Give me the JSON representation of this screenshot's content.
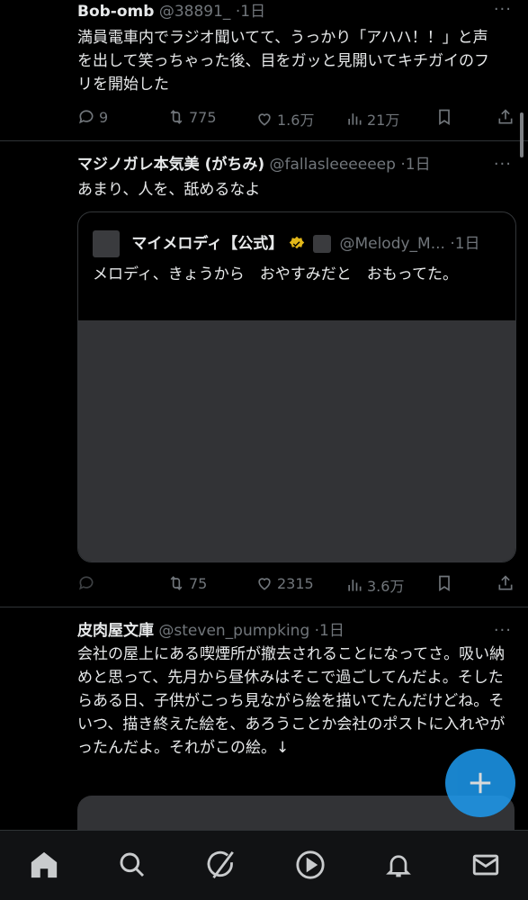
{
  "tweets": [
    {
      "name": "Bob-omb",
      "handle": "@38891_",
      "time": "·1日",
      "text": "満員電車内でラジオ聞いてて、うっかり「アハハ！！」と声を出して笑っちゃった後、目をガッと見開いてキチガイのフリを開始した",
      "replies": "9",
      "reposts": "775",
      "likes": "1.6万",
      "views": "21万"
    },
    {
      "name": "マジノガレ本気美 (がちみ)",
      "handle": "@fallasleeeeeep",
      "time": "·1日",
      "text": "あまり、人を、舐めるなよ",
      "replies": "",
      "reposts": "75",
      "likes": "2315",
      "views": "3.6万",
      "quote": {
        "name": "マイメロディ【公式】",
        "handle": "@Melody_M...",
        "time": "·1日",
        "text": "メロディ、きょうから　おやすみだと　おもってた。"
      }
    },
    {
      "name": "皮肉屋文庫",
      "handle": "@steven_pumpking",
      "time": "·1日",
      "text": "会社の屋上にある喫煙所が撤去されることになってさ。吸い納めと思って、先月から昼休みはそこで過ごしてんだよ。そしたらある日、子供がこっち見ながら絵を描いてたんだけどね。そいつ、描き終えた絵を、あろうことか会社のポストに入れやがったんだよ。それがこの絵。↓"
    }
  ],
  "more_glyph": "···",
  "colors": {
    "accent": "#1d9bf0",
    "verified": "#e2b719"
  },
  "nav": [
    "home-icon",
    "search-icon",
    "grok-icon",
    "video-icon",
    "notifications-icon",
    "messages-icon"
  ]
}
